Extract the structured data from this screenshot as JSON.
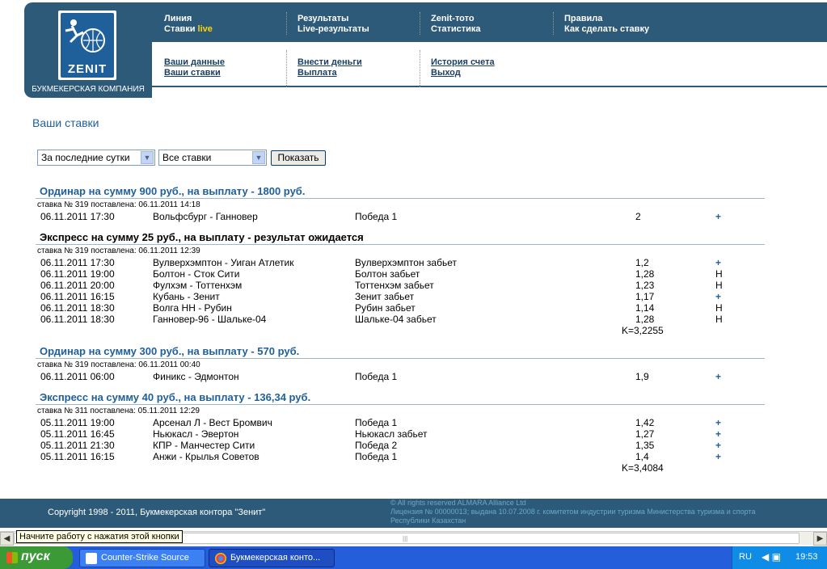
{
  "logo": {
    "word": "ZENIT",
    "tagline": "БУКМЕКЕРСКАЯ КОМПАНИЯ"
  },
  "top_nav": [
    {
      "line1": "Линия",
      "line2a": "Ставки ",
      "line2b": "live"
    },
    {
      "line1": "Результаты",
      "line2a": "Live-результаты",
      "line2b": ""
    },
    {
      "line1": "Zenit-тото",
      "line2a": "Статистика",
      "line2b": ""
    },
    {
      "line1": "Правила",
      "line2a": "Как сделать ставку",
      "line2b": ""
    }
  ],
  "sub_nav": [
    {
      "a": "Ваши данные",
      "b": "Ваши ставки"
    },
    {
      "a": "Внести деньги",
      "b": "Выплата"
    },
    {
      "a": "История счета",
      "b": "Выход"
    }
  ],
  "page_title": "Ваши ставки",
  "filters": {
    "period": "За последние сутки",
    "type": "Все ставки",
    "show_label": "Показать"
  },
  "bets": [
    {
      "header": "Ординар на сумму 900 руб., на выплату - 1800 руб.",
      "placed": "ставка № 319 поставлена: 06.11.2011 14:18",
      "rows": [
        {
          "date": "06.11.2011 17:30",
          "match": "Вольфсбург - Ганновер",
          "outcome": "Победа 1",
          "coef": "2",
          "mark": "+"
        }
      ],
      "total": ""
    },
    {
      "header": "Экспресс на сумму 25 руб., на выплату - результат ожидается",
      "placed": "ставка № 319 поставлена: 06.11.2011 12:39",
      "rows": [
        {
          "date": "06.11.2011 17:30",
          "match": "Вулверхэмптон - Уиган Атлетик",
          "outcome": "Вулверхэмптон забьет",
          "coef": "1,2",
          "mark": "+"
        },
        {
          "date": "06.11.2011 19:00",
          "match": "Болтон - Сток Сити",
          "outcome": "Болтон забьет",
          "coef": "1,28",
          "mark": "Н"
        },
        {
          "date": "06.11.2011 20:00",
          "match": "Фулхэм - Тоттенхэм",
          "outcome": "Тоттенхэм забьет",
          "coef": "1,23",
          "mark": "Н"
        },
        {
          "date": "06.11.2011 16:15",
          "match": "Кубань - Зенит",
          "outcome": "Зенит забьет",
          "coef": "1,17",
          "mark": "+"
        },
        {
          "date": "06.11.2011 18:30",
          "match": "Волга НН - Рубин",
          "outcome": "Рубин забьет",
          "coef": "1,14",
          "mark": "Н"
        },
        {
          "date": "06.11.2011 18:30",
          "match": "Ганновер-96 - Шальке-04",
          "outcome": "Шальке-04 забьет",
          "coef": "1,28",
          "mark": "Н"
        }
      ],
      "total": "K=3,2255"
    },
    {
      "header": "Ординар на сумму 300 руб., на выплату - 570 руб.",
      "placed": "ставка № 319 поставлена: 06.11.2011 00:40",
      "rows": [
        {
          "date": "06.11.2011 06:00",
          "match": "Финикс - Эдмонтон",
          "outcome": "Победа 1",
          "coef": "1,9",
          "mark": "+"
        }
      ],
      "total": ""
    },
    {
      "header": "Экспресс на сумму 40 руб., на выплату - 136,34 руб.",
      "placed": "ставка № 311 поставлена: 05.11.2011 12:29",
      "rows": [
        {
          "date": "05.11.2011 19:00",
          "match": "Арсенал Л - Вест Бромвич",
          "outcome": "Победа 1",
          "coef": "1,42",
          "mark": "+"
        },
        {
          "date": "05.11.2011 16:45",
          "match": "Ньюкасл - Эвертон",
          "outcome": "Ньюкасл забьет",
          "coef": "1,27",
          "mark": "+"
        },
        {
          "date": "05.11.2011 21:30",
          "match": "КПР - Манчестер Сити",
          "outcome": "Победа 2",
          "coef": "1,35",
          "mark": "+"
        },
        {
          "date": "05.11.2011 16:15",
          "match": "Анжи - Крылья Советов",
          "outcome": "Победа 1",
          "coef": "1,4",
          "mark": "+"
        }
      ],
      "total": "K=3,4084"
    }
  ],
  "footer": {
    "copyright": "Copyright 1998 - 2011, Букмекерская контора \"Зенит\"",
    "rights_1": "© All rights reserved ALMARA Alliance Ltd",
    "rights_2": "Лицензия № 00000013; выдана 10.07.2008 г. комитетом индустрии туризма Министерства туризма и спорта Республики Казахстан"
  },
  "tooltip": "Начните работу с нажатия этой кнопки",
  "taskbar": {
    "start_label": "пуск",
    "tasks": [
      "Counter-Strike Source",
      "Букмекерская конто..."
    ],
    "lang": "RU",
    "clock": "19:53"
  }
}
